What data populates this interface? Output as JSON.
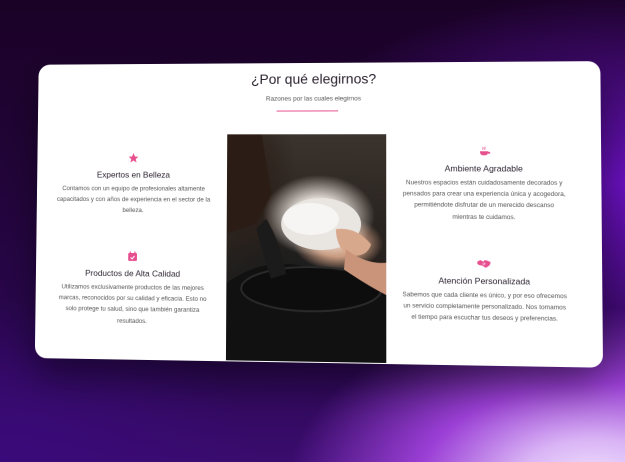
{
  "section": {
    "title": "¿Por qué elegirnos?",
    "subtitle": "Razones por las cuales elegirnos"
  },
  "features": {
    "left_top": {
      "icon": "star-icon",
      "icon_glyph": "★",
      "title": "Expertos en Belleza",
      "description": "Contamos con un equipo de profesionales altamente capacitados y con años de experiencia en el sector de la belleza."
    },
    "left_bottom": {
      "icon": "calendar-icon",
      "icon_glyph": "📅",
      "title": "Productos de Alta Calidad",
      "description": "Utilizamos exclusivamente productos de las mejores marcas, reconocidos por su calidad y eficacia. Esto no solo protege tu salud, sino que también garantiza resultados."
    },
    "right_top": {
      "icon": "spa-icon",
      "icon_glyph": "♨",
      "title": "Ambiente Agradable",
      "description": "Nuestros espacios están cuidadosamente decorados y pensados para crear una experiencia única y acogedora, permitiéndote disfrutar de un merecido descanso mientras te cuidamos."
    },
    "right_bottom": {
      "icon": "handshake-icon",
      "icon_glyph": "🤝",
      "title": "Atención Personalizada",
      "description": "Sabemos que cada cliente es único, y por eso ofrecemos un servicio completamente personalizado. Nos tomamos el tiempo para escuchar tus deseos y preferencias."
    }
  },
  "colors": {
    "accent": "#e7508f",
    "heading": "#2a2230",
    "body_text": "#555555"
  }
}
